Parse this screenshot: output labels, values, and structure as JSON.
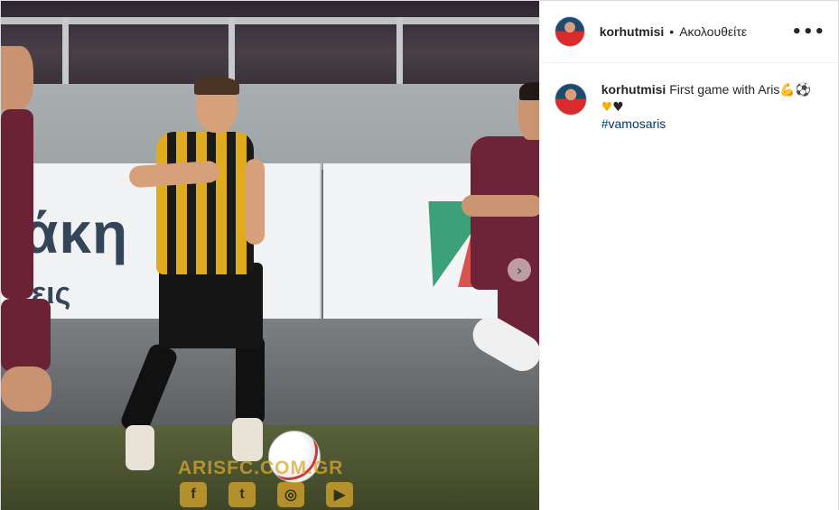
{
  "post": {
    "username": "korhutmisi",
    "separator": "•",
    "follow_status": "Ακολουθείτε",
    "more_icon": "•••",
    "caption": {
      "username": "korhutmisi",
      "text": "First game with Aris",
      "emoji_1": "💪",
      "emoji_2": "⚽",
      "heart_gold": "♥",
      "heart_black": "♥",
      "hashtag": "#vamosaris"
    }
  },
  "photo": {
    "board_text_large": "άκη",
    "board_text_small": "εις",
    "watermark": "ARISFC.COM.GR",
    "social_icons": [
      "f",
      "t",
      "◎",
      "▶"
    ],
    "next_arrow": "›"
  },
  "colors": {
    "aris_gold": "#e0ab1d",
    "opponent_maroon": "#6e2438",
    "hashtag_blue": "#00376b"
  }
}
